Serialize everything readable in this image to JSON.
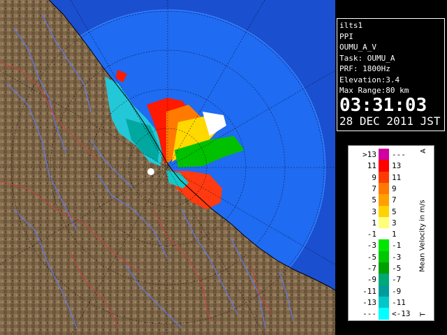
{
  "info": {
    "site": "ilts1",
    "product": "PPI",
    "source": "OUMU_A_V",
    "task": "Task: OUMU_A",
    "prf": "PRF: 1800Hz",
    "elevation": "Elevation:3.4",
    "max_range": "Max Range:80 km",
    "time": "03:31:03",
    "date": "28 DEC 2011 JST"
  },
  "legend": {
    "title": "Mean Velocity in m/s",
    "corner_top": "A",
    "corner_bottom": "T",
    "rows": [
      {
        "lo": ">13",
        "hi": "---",
        "color": "#d000a0"
      },
      {
        "lo": "11",
        "hi": "13",
        "color": "#ff0000"
      },
      {
        "lo": "9",
        "hi": "11",
        "color": "#ff3c00"
      },
      {
        "lo": "7",
        "hi": "9",
        "color": "#ff7800"
      },
      {
        "lo": "5",
        "hi": "7",
        "color": "#ffa000"
      },
      {
        "lo": "3",
        "hi": "5",
        "color": "#ffd200"
      },
      {
        "lo": "1",
        "hi": "3",
        "color": "#ffff78"
      },
      {
        "lo": "-1",
        "hi": "1",
        "color": "#ffffff"
      },
      {
        "lo": "-3",
        "hi": "-1",
        "color": "#00e600"
      },
      {
        "lo": "-5",
        "hi": "-3",
        "color": "#00c800"
      },
      {
        "lo": "-7",
        "hi": "-5",
        "color": "#00a000"
      },
      {
        "lo": "-9",
        "hi": "-7",
        "color": "#00a878"
      },
      {
        "lo": "-11",
        "hi": "-9",
        "color": "#009c9c"
      },
      {
        "lo": "-13",
        "hi": "-11",
        "color": "#00c8c8"
      },
      {
        "lo": "---",
        "hi": "<-13",
        "color": "#00ffff"
      }
    ]
  },
  "colors": {
    "sea": "#1f6bf2",
    "sea_outer": "#1450c0",
    "land": "#7a6448",
    "river": "#5a7cff",
    "border": "#c83c3c"
  }
}
